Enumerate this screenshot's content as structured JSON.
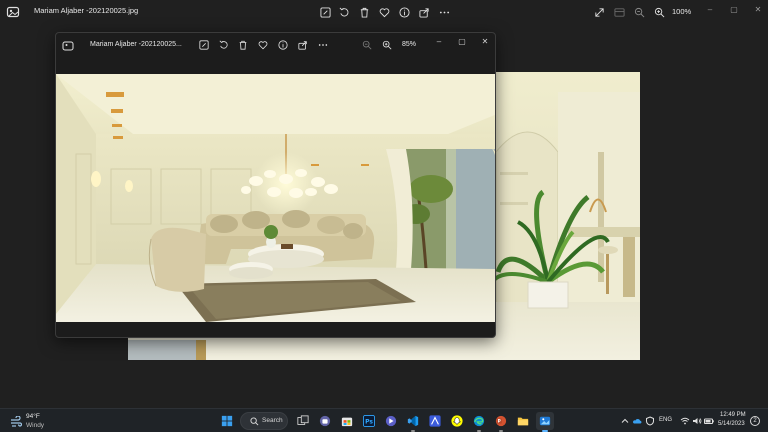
{
  "main_window": {
    "title": "Mariam Aljaber -202120025.jpg",
    "zoom": "100%",
    "toolbar_icons": [
      "edit-icon",
      "rotate-icon",
      "delete-icon",
      "favorite-icon",
      "info-icon",
      "share-icon",
      "more-icon"
    ],
    "view_icons": [
      "fullscreen-icon",
      "slideshow-icon",
      "zoom-out-icon",
      "zoom-in-icon"
    ]
  },
  "secondary_window": {
    "title": "Mariam Aljaber -202120025...",
    "zoom": "85%",
    "toolbar_icons": [
      "edit-icon",
      "rotate-icon",
      "delete-icon",
      "favorite-icon",
      "info-icon",
      "share-icon",
      "more-icon"
    ]
  },
  "window_controls": {
    "minimize": "–",
    "maximize": "▢",
    "close": "✕"
  },
  "taskbar": {
    "weather": {
      "temp": "94°F",
      "condition": "Windy"
    },
    "search_label": "Search",
    "apps": [
      "start-icon",
      "task-view-icon",
      "teams-icon",
      "store-icon",
      "photoshop-icon",
      "app-icon",
      "vscode-icon",
      "editor-icon",
      "snapchat-icon",
      "edge-icon",
      "powerpoint-icon",
      "file-explorer-icon",
      "photos-icon"
    ],
    "language": "ENG",
    "time": "12:49 PM",
    "date": "5/14/2023",
    "notifications": "2"
  },
  "colors": {
    "accent": "#5cb4ff",
    "background": "#202020",
    "taskbar": "#1f2327"
  }
}
